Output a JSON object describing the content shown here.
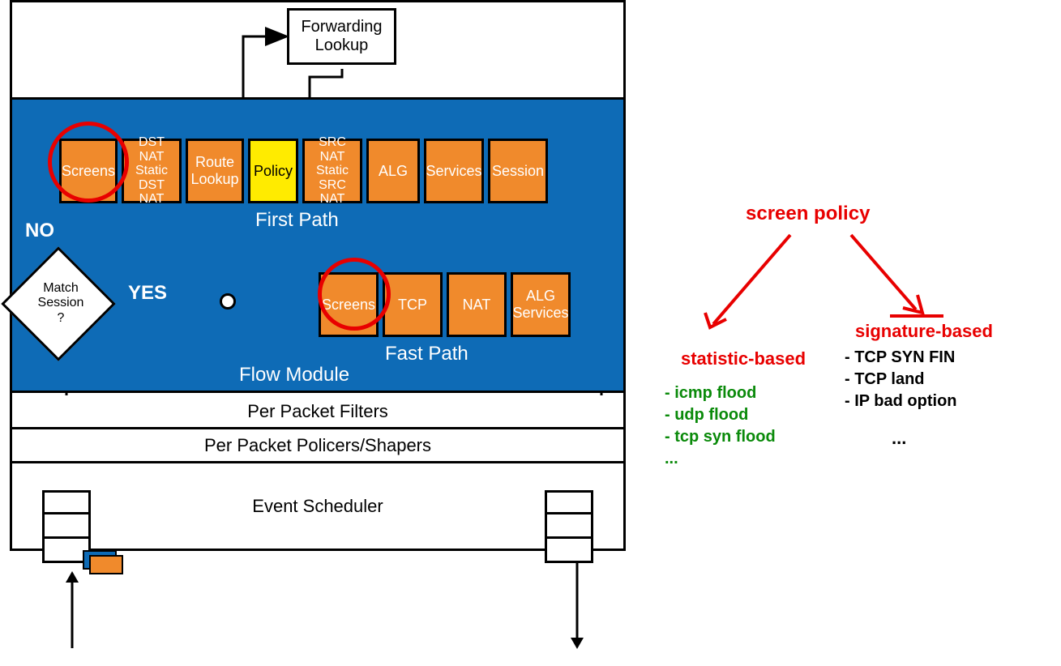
{
  "forwarding_lookup": "Forwarding\nLookup",
  "first_path": {
    "boxes": {
      "screens": "Screens",
      "dstnat": "DST NAT\nStatic\nDST NAT",
      "route": "Route\nLookup",
      "policy": "Policy",
      "srcnat": "SRC NAT\nStatic\nSRC NAT",
      "alg": "ALG",
      "services": "Services",
      "session": "Session"
    },
    "label": "First Path"
  },
  "fast_path": {
    "boxes": {
      "screens": "Screens",
      "tcp": "TCP",
      "nat": "NAT",
      "alg_services": "ALG\nServices"
    },
    "label": "Fast Path"
  },
  "flow_module": "Flow Module",
  "no_label": "NO",
  "yes_label": "YES",
  "match_session": "Match\nSession\n?",
  "filters": {
    "per_packet_filters": "Per Packet Filters",
    "per_packet_policers": "Per Packet Policers/Shapers",
    "event_scheduler": "Event Scheduler"
  },
  "annotations": {
    "screen_policy": "screen policy",
    "statistic_based": "statistic-based",
    "signature_based": "signature-based",
    "stat_items": [
      "- icmp flood",
      "- udp flood",
      "- tcp syn flood",
      "   ..."
    ],
    "sig_items": [
      "- TCP SYN FIN",
      "- TCP land",
      "- IP bad option"
    ],
    "sig_ellipsis": "..."
  }
}
